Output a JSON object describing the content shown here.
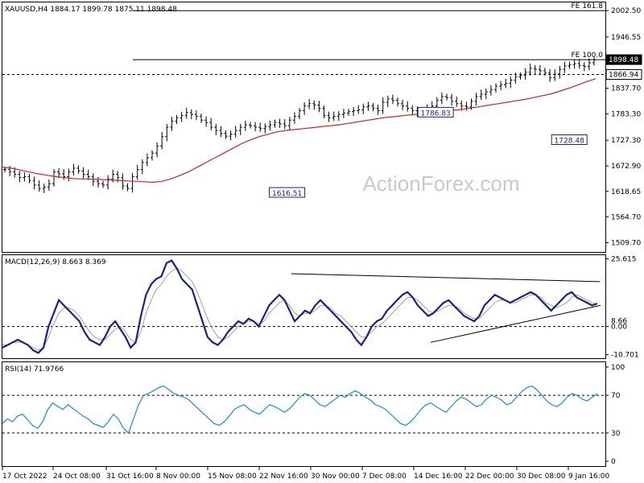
{
  "watermark": "ActionForex.com",
  "colors": {
    "bar": "#000000",
    "ma": "#d62020",
    "macd": "#1a237e",
    "signal": "#a0a0a0",
    "rsi": "#1e88e5",
    "grid": "#000000",
    "price_box_bg": "#000000",
    "price_box_text": "#ffffff"
  },
  "chart_data": [
    {
      "type": "line",
      "title": "XAUUSD,H4  1884.17 1899.78 1875.11 1898.48",
      "symbol": "XAUUSD,H4",
      "ohlc": {
        "open": 1884.17,
        "high": 1899.78,
        "low": 1875.11,
        "close": 1898.48
      },
      "ylim": [
        1490,
        2020
      ],
      "y_ticks": [
        "2002.50",
        "1946.55",
        "1892.40",
        "1837.70",
        "1783.30",
        "1727.30",
        "1672.90",
        "1618.65",
        "1564.70",
        "1509.70"
      ],
      "y_tick_values": [
        2002.5,
        1946.55,
        1892.4,
        1837.7,
        1783.3,
        1727.3,
        1672.9,
        1618.65,
        1564.7,
        1509.7
      ],
      "x_ticks": [
        "17 Oct 2022",
        "24 Oct 08:00",
        "31 Oct 16:00",
        "8 Nov 00:00",
        "15 Nov 08:00",
        "22 Nov 16:00",
        "30 Nov 00:00",
        "7 Dec 08:00",
        "14 Dec 16:00",
        "22 Dec 00:00",
        "30 Dec 08:00",
        "9 Jan 16:00"
      ],
      "series": [
        {
          "name": "Price",
          "values": [
            1665,
            1660,
            1655,
            1648,
            1650,
            1642,
            1632,
            1625,
            1628,
            1635,
            1660,
            1656,
            1650,
            1660,
            1668,
            1662,
            1655,
            1650,
            1640,
            1635,
            1632,
            1645,
            1655,
            1648,
            1630,
            1625,
            1650,
            1665,
            1680,
            1690,
            1700,
            1715,
            1735,
            1755,
            1768,
            1775,
            1780,
            1786,
            1782,
            1778,
            1770,
            1765,
            1755,
            1748,
            1742,
            1736,
            1740,
            1748,
            1755,
            1760,
            1758,
            1755,
            1752,
            1756,
            1760,
            1765,
            1762,
            1758,
            1770,
            1778,
            1790,
            1800,
            1805,
            1802,
            1795,
            1780,
            1775,
            1778,
            1782,
            1785,
            1788,
            1790,
            1792,
            1798,
            1800,
            1795,
            1790,
            1808,
            1815,
            1812,
            1805,
            1800,
            1795,
            1790,
            1785,
            1788,
            1795,
            1800,
            1812,
            1820,
            1818,
            1810,
            1805,
            1800,
            1798,
            1810,
            1820,
            1825,
            1830,
            1835,
            1842,
            1845,
            1848,
            1855,
            1862,
            1865,
            1872,
            1880,
            1878,
            1875,
            1870,
            1860,
            1868,
            1878,
            1885,
            1888,
            1890,
            1886,
            1884,
            1892,
            1898
          ]
        },
        {
          "name": "MA",
          "values": [
            1670,
            1668,
            1664,
            1660,
            1656,
            1653,
            1650,
            1648,
            1646,
            1645,
            1645,
            1644,
            1643,
            1642,
            1641,
            1640,
            1639,
            1638,
            1640,
            1645,
            1652,
            1660,
            1670,
            1680,
            1690,
            1700,
            1710,
            1720,
            1728,
            1735,
            1740,
            1745,
            1748,
            1750,
            1752,
            1754,
            1756,
            1758,
            1760,
            1763,
            1766,
            1769,
            1772,
            1775,
            1777,
            1779,
            1781,
            1783,
            1785,
            1787,
            1789,
            1791,
            1793,
            1796,
            1799,
            1802,
            1805,
            1808,
            1811,
            1814,
            1818,
            1822,
            1826,
            1832,
            1838,
            1845,
            1852,
            1858
          ]
        }
      ],
      "levels": [
        {
          "label": "FE 161.8",
          "value": 2002.5,
          "style": "solid"
        },
        {
          "label": "FE 100.0",
          "value": 1898.48,
          "style": "solid"
        },
        {
          "label": "",
          "value": 1866.94,
          "style": "dashed"
        }
      ],
      "price_boxes": [
        "1898.48",
        "1866.94"
      ],
      "annotations": [
        {
          "text": "1786.83",
          "x_index": 29,
          "value": 1786.83
        },
        {
          "text": "1728.48",
          "x_index": 38,
          "value": 1728.48
        },
        {
          "text": "1616.51",
          "x_index": 19,
          "value": 1616.51
        }
      ]
    },
    {
      "type": "line",
      "title": "MACD(12,26,9) 8.663 8.369",
      "ylim": [
        -12,
        27
      ],
      "y_ticks": [
        "25.615",
        "0.00",
        "-10.701"
      ],
      "y_tick_values": [
        25.615,
        0,
        -10.701
      ],
      "y_tick_extra": "8.66",
      "series": [
        {
          "name": "MACD",
          "values": [
            -8,
            -7,
            -6,
            -5,
            -6,
            -7,
            -9,
            -10,
            -8,
            0,
            5,
            10,
            8,
            6,
            4,
            2,
            -2,
            -5,
            -6,
            -7,
            -4,
            0,
            2,
            -1,
            -4,
            -8,
            -6,
            4,
            12,
            16,
            18,
            19,
            24,
            25,
            22,
            18,
            16,
            14,
            8,
            2,
            -4,
            -6,
            -7,
            -5,
            -2,
            0,
            2,
            1,
            3,
            2,
            0,
            4,
            8,
            10,
            12,
            10,
            6,
            2,
            4,
            6,
            5,
            8,
            10,
            8,
            6,
            4,
            2,
            0,
            -2,
            -5,
            -7,
            -4,
            0,
            2,
            3,
            6,
            8,
            10,
            12,
            13,
            11,
            8,
            6,
            4,
            5,
            7,
            9,
            10,
            8,
            6,
            4,
            3,
            2,
            4,
            8,
            10,
            12,
            11,
            10,
            9,
            10,
            11,
            12,
            13,
            12,
            10,
            8,
            6,
            8,
            10,
            12,
            13,
            11,
            10,
            9,
            8,
            8.7
          ]
        },
        {
          "name": "Signal",
          "values": [
            -7,
            -7,
            -6,
            -6,
            -6,
            -7,
            -8,
            -9,
            -8,
            -4,
            1,
            5,
            7,
            7,
            6,
            4,
            1,
            -2,
            -4,
            -5,
            -5,
            -3,
            -1,
            0,
            -2,
            -5,
            -6,
            -2,
            5,
            10,
            14,
            16,
            19,
            21,
            22,
            21,
            19,
            17,
            13,
            8,
            3,
            -1,
            -4,
            -5,
            -4,
            -2,
            0,
            1,
            2,
            2,
            1,
            2,
            5,
            7,
            9,
            10,
            8,
            5,
            4,
            5,
            5,
            6,
            8,
            8,
            7,
            5,
            4,
            2,
            0,
            -2,
            -4,
            -4,
            -2,
            0,
            1,
            3,
            5,
            7,
            9,
            11,
            11,
            10,
            8,
            6,
            5,
            6,
            7,
            8,
            8,
            7,
            5,
            4,
            3,
            3,
            5,
            7,
            9,
            10,
            10,
            9,
            9,
            10,
            11,
            12,
            12,
            11,
            9,
            8,
            7,
            8,
            9,
            11,
            12,
            11,
            10,
            9,
            8.4
          ]
        }
      ]
    },
    {
      "type": "line",
      "title": "RSI(14) 71.9766",
      "ylim": [
        0,
        100
      ],
      "y_ticks": [
        "100",
        "70",
        "30",
        "0"
      ],
      "y_tick_values": [
        100,
        70,
        30,
        0
      ],
      "series": [
        {
          "name": "RSI",
          "values": [
            40,
            45,
            42,
            48,
            50,
            44,
            38,
            35,
            42,
            55,
            62,
            58,
            55,
            60,
            56,
            52,
            48,
            45,
            40,
            38,
            36,
            42,
            50,
            45,
            35,
            30,
            45,
            60,
            70,
            72,
            75,
            78,
            80,
            76,
            72,
            70,
            68,
            65,
            60,
            55,
            50,
            45,
            40,
            38,
            42,
            48,
            55,
            58,
            60,
            55,
            52,
            50,
            55,
            60,
            58,
            55,
            52,
            56,
            62,
            68,
            72,
            70,
            65,
            60,
            58,
            62,
            66,
            70,
            68,
            72,
            75,
            72,
            68,
            65,
            60,
            58,
            55,
            50,
            45,
            40,
            38,
            42,
            48,
            55,
            60,
            62,
            58,
            55,
            52,
            58,
            64,
            68,
            66,
            62,
            58,
            60,
            66,
            70,
            68,
            65,
            60,
            62,
            68,
            74,
            78,
            80,
            76,
            70,
            64,
            60,
            58,
            62,
            68,
            72,
            70,
            66,
            64,
            68,
            72
          ]
        }
      ]
    }
  ]
}
